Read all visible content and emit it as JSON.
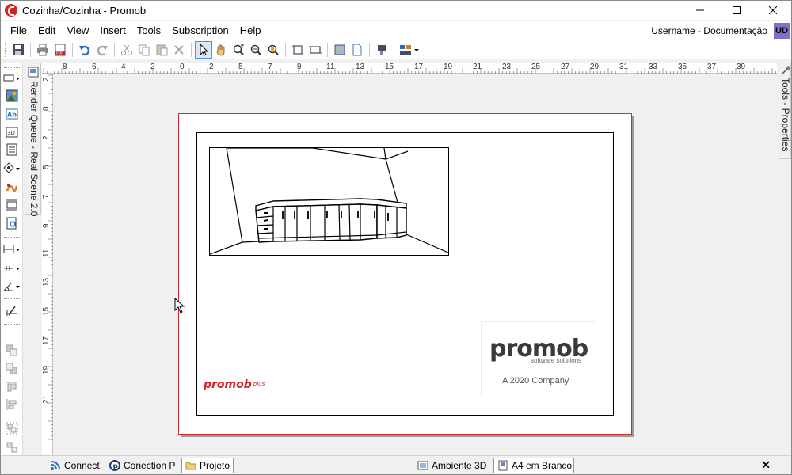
{
  "window": {
    "title": "Cozinha/Cozinha - Promob"
  },
  "menu": {
    "items": [
      "File",
      "Edit",
      "View",
      "Insert",
      "Tools",
      "Subscription",
      "Help"
    ]
  },
  "user": {
    "name": "Username - Documentação",
    "initials": "UD"
  },
  "side_tabs": {
    "left": "Render Queue - Real Scene 2.0",
    "right": "Tools - Properties"
  },
  "ruler": {
    "horizontal_labels": [
      "8",
      "6",
      "4",
      "2",
      "0",
      "2",
      "5",
      "7",
      "9",
      "11",
      "13",
      "15",
      "17",
      "19",
      "21",
      "23",
      "25",
      "27",
      "29",
      "31",
      "33",
      "35",
      "37",
      "39"
    ],
    "vertical_labels": [
      "2",
      "0",
      "2",
      "5",
      "7",
      "9",
      "11",
      "13",
      "15",
      "17",
      "19",
      "21"
    ]
  },
  "page": {
    "logo_main": "promob",
    "logo_sub": "software solutions",
    "logo_company": "A 2020 Company",
    "brand_small": "promob",
    "brand_small_sup": "plus"
  },
  "bottom_tabs": [
    {
      "label": "Connect",
      "icon": "rss-icon"
    },
    {
      "label": "Conection P",
      "icon": "promob-p-icon"
    },
    {
      "label": "Projeto",
      "icon": "folder-icon",
      "selected": true
    },
    {
      "label": "Ambiente 3D",
      "icon": "ambient-3d-icon"
    },
    {
      "label": "A4 em Branco",
      "icon": "sheet-icon",
      "selected": true
    }
  ],
  "colors": {
    "brand_red": "#d62020",
    "page_border": "#d12b2b",
    "user_badge": "#7c72c9"
  }
}
